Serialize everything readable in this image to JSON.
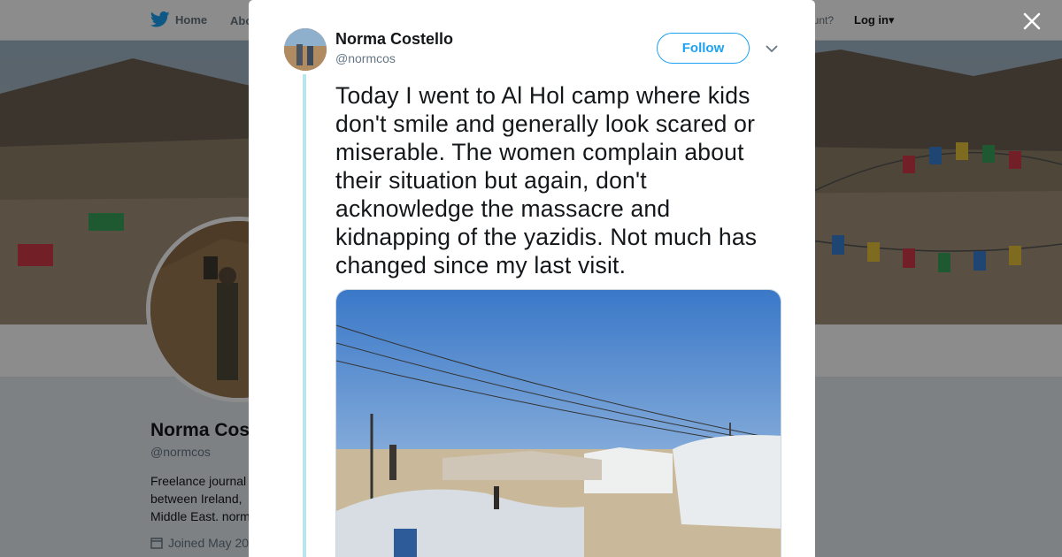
{
  "nav": {
    "home_label": "Home",
    "about_label": "Abo",
    "account_prompt": "ccount?",
    "login_label": "Log in"
  },
  "profile": {
    "name": "Norma Cos",
    "handle": "@normcos",
    "bio": "Freelance journal between Ireland, Middle East. norm",
    "joined": "Joined May 20"
  },
  "tweet": {
    "author_name": "Norma Costello",
    "author_handle": "@normcos",
    "follow_label": "Follow",
    "text": "Today I went to Al Hol camp where kids don't smile and generally look scared or miserable. The women complain about their situation but again, don't acknowledge the massacre and kidnapping of the yazidis. Not much has changed since my last visit."
  },
  "icons": {
    "twitter": "twitter-bird-icon",
    "close": "close-icon",
    "caret": "chevron-down-icon",
    "calendar": "calendar-icon"
  },
  "colors": {
    "brand": "#1da1f2",
    "text": "#14171a",
    "muted": "#657786",
    "thread": "#b8e6ee"
  }
}
